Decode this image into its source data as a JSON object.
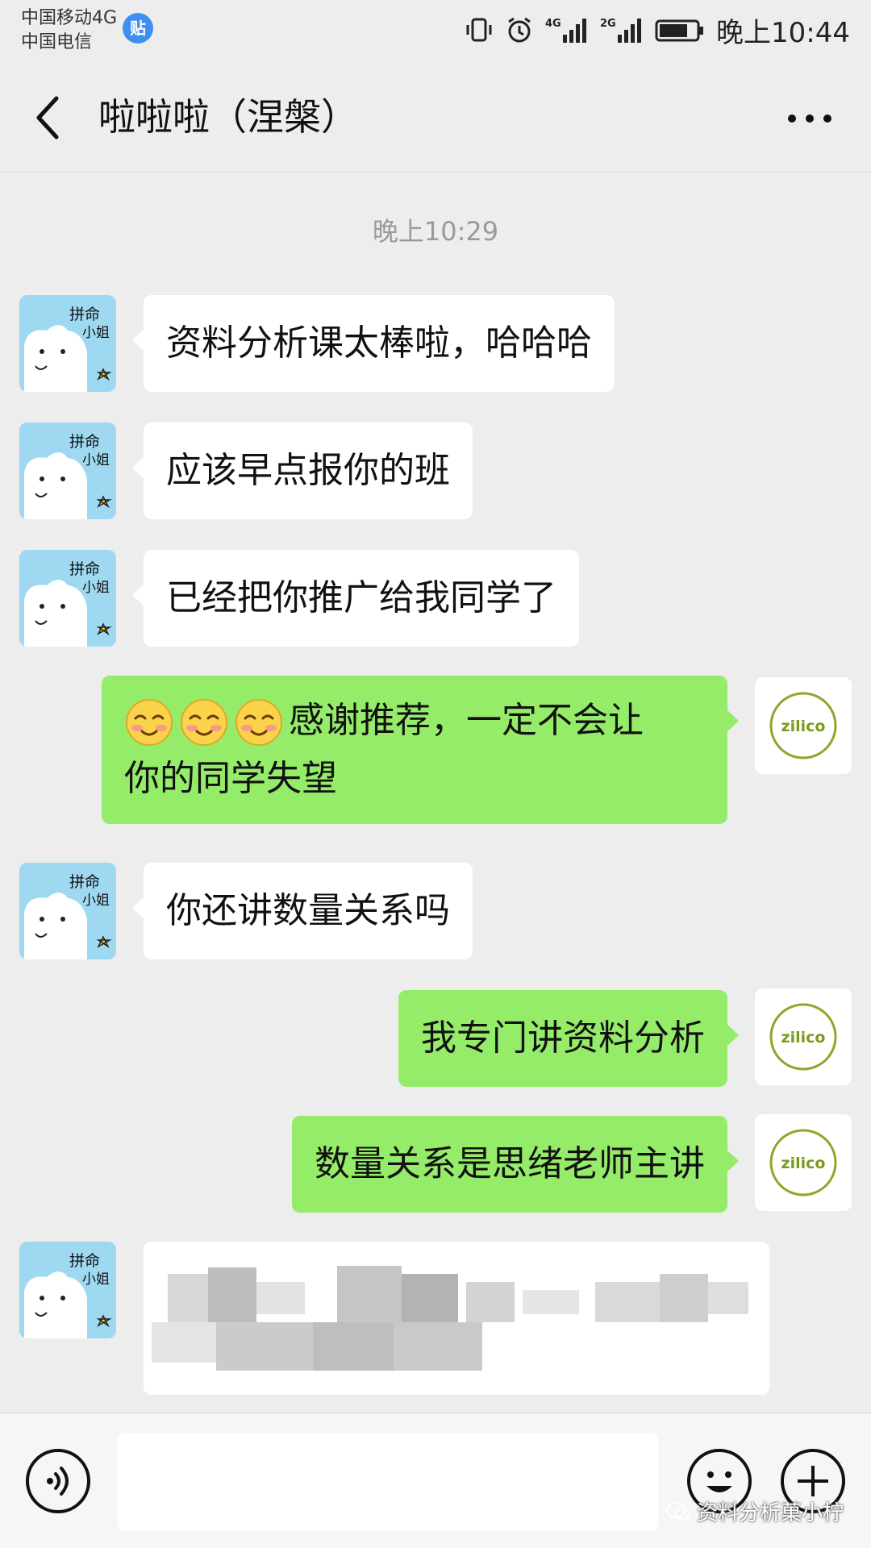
{
  "status_bar": {
    "carrier_1": "中国移动4G",
    "carrier_2": "中国电信",
    "badge_icon": "tieba-icon",
    "badge_text": "贴",
    "network_1": "4G",
    "network_2": "2G",
    "time": "晚上10:44"
  },
  "header": {
    "title": "啦啦啦（涅槃）",
    "back_icon": "chevron-left-icon",
    "more_icon": "more-dots-icon"
  },
  "chat": {
    "timestamp": "晚上10:29",
    "friend_avatar_text": [
      "拼命",
      "小姐"
    ],
    "my_avatar_text": "zilico",
    "messages": [
      {
        "from": "friend",
        "text": "资料分析课太棒啦，哈哈哈"
      },
      {
        "from": "friend",
        "text": "应该早点报你的班"
      },
      {
        "from": "friend",
        "text": "已经把你推广给我同学了"
      },
      {
        "from": "me",
        "emoji_count": 3,
        "emoji": "smile-emoji",
        "text_line1": "感谢推荐，一定不会让",
        "text_line2": "你的同学失望"
      },
      {
        "from": "friend",
        "text": "你还讲数量关系吗"
      },
      {
        "from": "me",
        "text": "我专门讲资料分析"
      },
      {
        "from": "me",
        "text": "数量关系是思绪老师主讲"
      },
      {
        "from": "friend",
        "text": "",
        "blurred": true
      }
    ]
  },
  "input_bar": {
    "voice_icon": "voice-icon",
    "emoji_icon": "emoji-face-icon",
    "plus_icon": "plus-icon",
    "input_value": ""
  },
  "watermark": "资料分析菓小柠",
  "colors": {
    "background": "#ededed",
    "bubble_out": "#95ec69",
    "bubble_in": "#ffffff",
    "friend_avatar_bg": "#9fd9f1"
  }
}
